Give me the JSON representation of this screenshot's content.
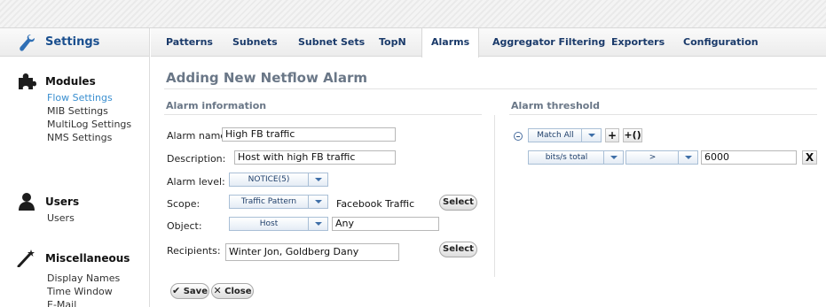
{
  "sidebar": {
    "title": "Settings",
    "sections": [
      {
        "heading": "Modules",
        "icon": "puzzle-icon",
        "items": [
          "Flow Settings",
          "MIB Settings",
          "MultiLog Settings",
          "NMS Settings"
        ]
      },
      {
        "heading": "Users",
        "icon": "user-icon",
        "items": [
          "Users"
        ]
      },
      {
        "heading": "Miscellaneous",
        "icon": "magic-wand-icon",
        "items": [
          "Display Names",
          "Time Window",
          "E-Mail"
        ]
      }
    ],
    "active_item": "Flow Settings"
  },
  "tabs": [
    "Patterns",
    "Subnets",
    "Subnet Sets",
    "TopN",
    "Alarms",
    "Aggregator Filtering",
    "Exporters",
    "Configuration"
  ],
  "active_tab": "Alarms",
  "page_title": "Adding New Netflow Alarm",
  "alarm_info": {
    "title": "Alarm information",
    "name_label": "Alarm name:",
    "name_value": "High FB traffic",
    "description_label": "Description:",
    "description_value": "Host with high FB traffic",
    "level_label": "Alarm level:",
    "level_value": "NOTICE(5)",
    "scope_label": "Scope:",
    "scope_value": "Traffic Pattern",
    "scope_text": "Facebook Traffic",
    "scope_select": "Select",
    "object_label": "Object:",
    "object_value": "Host",
    "object_input": "Any",
    "recipients_label": "Recipients:",
    "recipients_value": "Winter Jon, Goldberg Dany",
    "recipients_select": "Select"
  },
  "threshold": {
    "title": "Alarm threshold",
    "match": "Match All",
    "add": "+",
    "add_group": "+()",
    "metric": "bits/s total",
    "operator": ">",
    "value": "6000",
    "remove": "X"
  },
  "actions": {
    "save": "Save",
    "close": "Close"
  },
  "colors": {
    "link_blue": "#3a8fd0",
    "tab_text": "#1a3a6a",
    "section_title": "#6a7787"
  }
}
